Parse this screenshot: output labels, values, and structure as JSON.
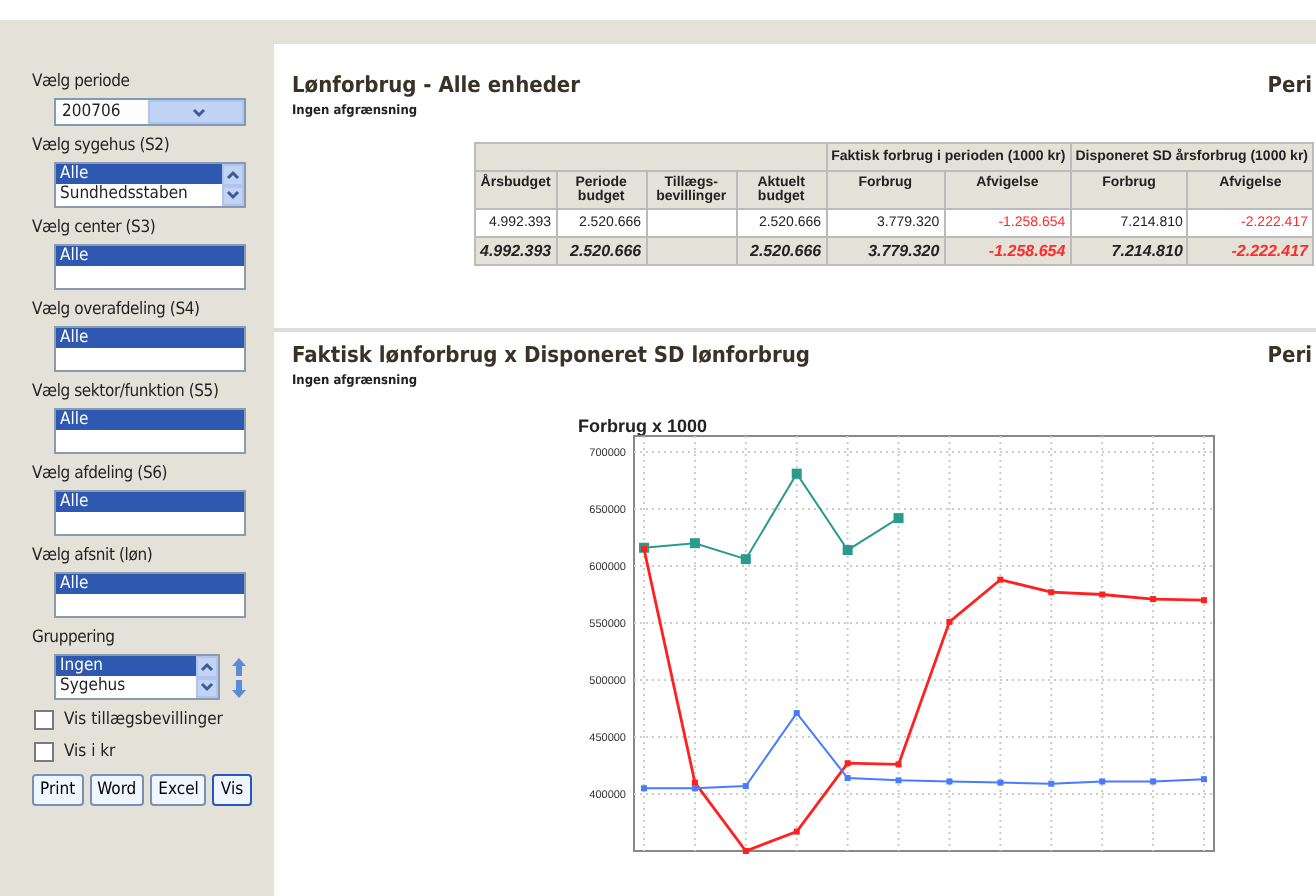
{
  "sidebar": {
    "filters": [
      {
        "label": "Vælg periode",
        "kind": "dropdown",
        "value": "200706"
      },
      {
        "label": "Vælg sygehus (S2)",
        "kind": "listbox",
        "scroll": true,
        "items": [
          {
            "text": "Alle",
            "selected": true
          },
          {
            "text": "Sundhedsstaben",
            "selected": false
          }
        ]
      },
      {
        "label": "Vælg center (S3)",
        "kind": "listbox",
        "scroll": false,
        "items": [
          {
            "text": "Alle",
            "selected": true
          }
        ]
      },
      {
        "label": "Vælg overafdeling (S4)",
        "kind": "listbox",
        "scroll": false,
        "items": [
          {
            "text": "Alle",
            "selected": true
          }
        ]
      },
      {
        "label": "Vælg sektor/funktion (S5)",
        "kind": "listbox",
        "scroll": false,
        "items": [
          {
            "text": "Alle",
            "selected": true
          }
        ]
      },
      {
        "label": "Vælg afdeling (S6)",
        "kind": "listbox",
        "scroll": false,
        "items": [
          {
            "text": "Alle",
            "selected": true
          }
        ]
      },
      {
        "label": "Vælg afsnit (løn)",
        "kind": "listbox",
        "scroll": false,
        "items": [
          {
            "text": "Alle",
            "selected": true
          }
        ]
      },
      {
        "label": "Gruppering",
        "kind": "orderlist",
        "scroll": true,
        "items": [
          {
            "text": "Ingen",
            "selected": true
          },
          {
            "text": "Sygehus",
            "selected": false
          }
        ]
      }
    ],
    "checkboxes": [
      {
        "label": "Vis tillægsbevillinger",
        "checked": false
      },
      {
        "label": "Vis i kr",
        "checked": false
      }
    ],
    "buttons": [
      {
        "label": "Print",
        "default": false
      },
      {
        "label": "Word",
        "default": false
      },
      {
        "label": "Excel",
        "default": false
      },
      {
        "label": "Vis",
        "default": true
      }
    ]
  },
  "report": {
    "title": "Lønforbrug - Alle enheder",
    "subtitle": "Ingen afgrænsning",
    "period_label": "Peri",
    "table": {
      "groups": [
        {
          "label": "Faktisk forbrug i perioden (1000 kr)"
        },
        {
          "label": "Disponeret SD årsforbrug (1000 kr)"
        }
      ],
      "columns": [
        "Årsbudget",
        "Periode budget",
        "Tillægs- bevillinger",
        "Aktuelt budget",
        "Forbrug",
        "Afvigelse",
        "Forbrug",
        "Afvigelse"
      ],
      "rows": [
        {
          "total": false,
          "cells": [
            {
              "value": "4.992.393",
              "negative": false
            },
            {
              "value": "2.520.666",
              "negative": false
            },
            null,
            {
              "value": "2.520.666",
              "negative": false
            },
            {
              "value": "3.779.320",
              "negative": false
            },
            {
              "value": "-1.258.654",
              "negative": true
            },
            {
              "value": "7.214.810",
              "negative": false
            },
            {
              "value": "-2.222.417",
              "negative": true
            }
          ]
        },
        {
          "total": true,
          "cells": [
            {
              "value": "4.992.393",
              "negative": false
            },
            {
              "value": "2.520.666",
              "negative": false
            },
            null,
            {
              "value": "2.520.666",
              "negative": false
            },
            {
              "value": "3.779.320",
              "negative": false
            },
            {
              "value": "-1.258.654",
              "negative": true
            },
            {
              "value": "7.214.810",
              "negative": false
            },
            {
              "value": "-2.222.417",
              "negative": true
            }
          ]
        }
      ]
    }
  },
  "chart_section": {
    "title": "Faktisk lønforbrug x Disponeret SD lønforbrug",
    "subtitle": "Ingen afgrænsning",
    "period_label": "Peri",
    "chart_data": {
      "type": "line",
      "title": "Forbrug x 1000",
      "grid": true,
      "ylim": [
        350000,
        700000
      ],
      "yticks": [
        400000,
        450000,
        500000,
        550000,
        600000,
        650000,
        700000
      ],
      "series": [
        {
          "color": "#2a9a8c",
          "marker": "square",
          "values": [
            616000,
            620000,
            606000,
            681000,
            614000,
            642000,
            null,
            null,
            null,
            null,
            null,
            null
          ]
        },
        {
          "color": "#ff2020",
          "marker": "square",
          "values": [
            615000,
            410000,
            350000,
            367000,
            427000,
            426000,
            551000,
            588000,
            577000,
            575000,
            571000,
            570000
          ]
        },
        {
          "color": "#4a7aff",
          "marker": "square",
          "values": [
            405000,
            405000,
            407000,
            471000,
            414000,
            412000,
            411000,
            410000,
            409000,
            411000,
            411000,
            413000
          ]
        }
      ]
    }
  }
}
